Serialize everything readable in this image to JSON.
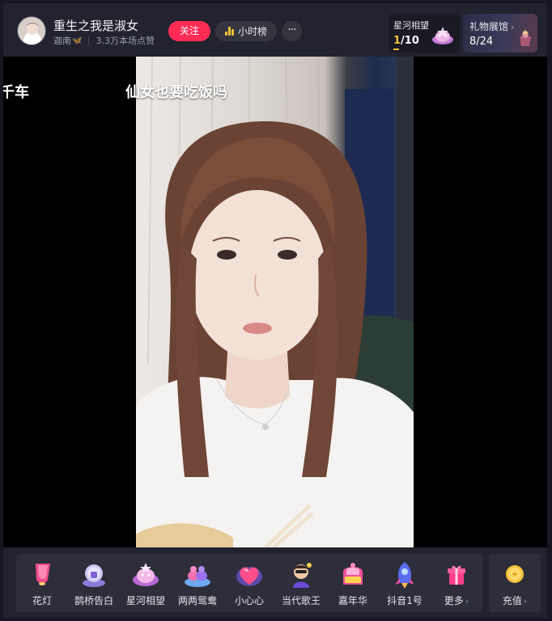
{
  "header": {
    "title": "重生之我是淑女",
    "anchor_name": "迦南",
    "likes": "3.3万本场点赞",
    "follow_label": "关注",
    "hour_rank_label": "小时榜",
    "more_label": "···",
    "galaxy": {
      "label": "星河相望",
      "current": "1",
      "total": "/10"
    },
    "gallery": {
      "label": "礼物展馆",
      "value": "8/24"
    }
  },
  "video": {
    "caption_left": "千车",
    "caption_main": "仙女也要吃饭吗"
  },
  "gifts": [
    {
      "label": "花灯",
      "icon": "lantern-icon"
    },
    {
      "label": "鹊桥告白",
      "icon": "magpie-bridge-icon"
    },
    {
      "label": "星河相望",
      "icon": "galaxy-icon"
    },
    {
      "label": "两两鸳鸯",
      "icon": "mandarin-ducks-icon"
    },
    {
      "label": "小心心",
      "icon": "heart-icon"
    },
    {
      "label": "当代歌王",
      "icon": "singer-icon"
    },
    {
      "label": "嘉年华",
      "icon": "carnival-icon"
    },
    {
      "label": "抖音1号",
      "icon": "rocket-icon"
    },
    {
      "label": "更多",
      "icon": "gift-box-icon"
    }
  ],
  "recharge": {
    "label": "充值"
  },
  "colors": {
    "accent": "#fe2c55",
    "gold": "#f5c33b",
    "panel": "#22232f"
  }
}
